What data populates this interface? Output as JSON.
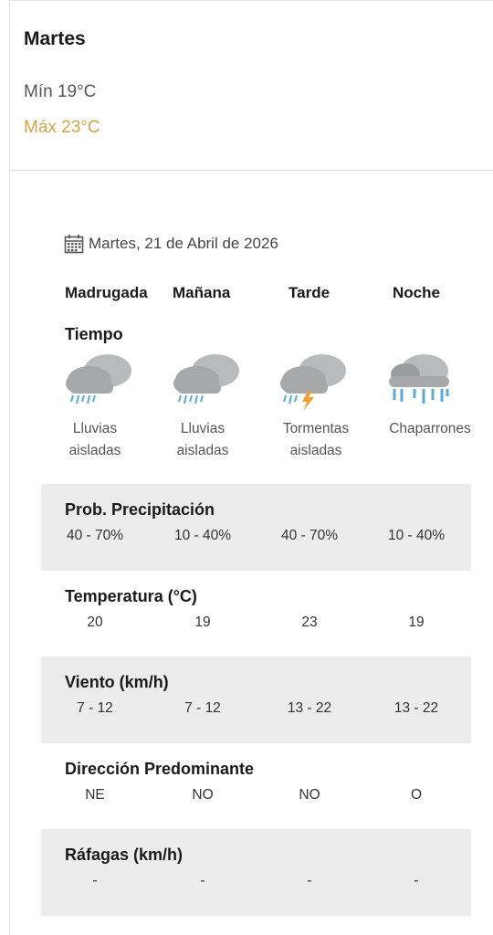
{
  "summary": {
    "day": "Martes",
    "min": "Mín 19°C",
    "max": "Máx 23°C"
  },
  "forecast": {
    "date": "Martes, 21 de Abril de 2026",
    "periods": [
      "Madrugada",
      "Mañana",
      "Tarde",
      "Noche"
    ],
    "weather_label": "Tiempo",
    "conditions": [
      {
        "line1": "Lluvias",
        "line2": "aisladas",
        "icon": "isolated-rain-icon"
      },
      {
        "line1": "Lluvias",
        "line2": "aisladas",
        "icon": "isolated-rain-icon"
      },
      {
        "line1": "Tormentas",
        "line2": "aisladas",
        "icon": "isolated-storm-icon"
      },
      {
        "line1": "Chaparrones",
        "line2": "",
        "icon": "showers-icon"
      }
    ],
    "rows": [
      {
        "title": "Prob. Precipitación",
        "values": [
          "40 - 70%",
          "10 - 40%",
          "40 - 70%",
          "10 - 40%"
        ]
      },
      {
        "title": "Temperatura (°C)",
        "values": [
          "20",
          "19",
          "23",
          "19"
        ]
      },
      {
        "title": "Viento (km/h)",
        "values": [
          "7 - 12",
          "7 - 12",
          "13 - 22",
          "13 - 22"
        ]
      },
      {
        "title": "Dirección Predominante",
        "values": [
          "NE",
          "NO",
          "NO",
          "O"
        ]
      },
      {
        "title": "Ráfagas (km/h)",
        "values": [
          "-",
          "-",
          "-",
          "-"
        ]
      }
    ]
  },
  "colors": {
    "max_temp": "#d4a346",
    "band_bg": "#ececec",
    "cloud": "#b4b6b8",
    "rain": "#5aa9d6",
    "lightning": "#f0a030"
  }
}
